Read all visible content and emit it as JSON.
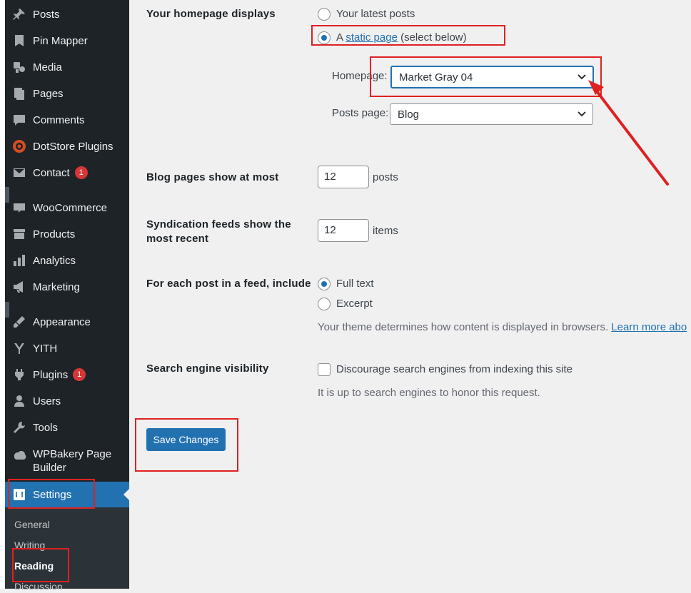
{
  "sidebar": {
    "items": [
      {
        "label": "Posts",
        "icon": "pin-icon"
      },
      {
        "label": "Pin Mapper",
        "icon": "pin-mapper-icon"
      },
      {
        "label": "Media",
        "icon": "media-icon"
      },
      {
        "label": "Pages",
        "icon": "pages-icon"
      },
      {
        "label": "Comments",
        "icon": "comments-icon"
      },
      {
        "label": "DotStore Plugins",
        "icon": "dotstore-icon"
      },
      {
        "label": "Contact",
        "icon": "mail-icon",
        "badge": "1"
      },
      {
        "label": "WooCommerce",
        "icon": "woo-icon"
      },
      {
        "label": "Products",
        "icon": "products-icon"
      },
      {
        "label": "Analytics",
        "icon": "analytics-icon"
      },
      {
        "label": "Marketing",
        "icon": "megaphone-icon"
      },
      {
        "label": "Appearance",
        "icon": "brush-icon"
      },
      {
        "label": "YITH",
        "icon": "yith-icon"
      },
      {
        "label": "Plugins",
        "icon": "plugin-icon",
        "badge": "1"
      },
      {
        "label": "Users",
        "icon": "users-icon"
      },
      {
        "label": "Tools",
        "icon": "wrench-icon"
      },
      {
        "label": "WPBakery Page Builder",
        "icon": "wpbakery-icon"
      },
      {
        "label": "Settings",
        "icon": "settings-icon"
      }
    ],
    "submenu": [
      "General",
      "Writing",
      "Reading",
      "Discussion"
    ]
  },
  "reading": {
    "homepage_displays": {
      "label": "Your homepage displays",
      "option_latest": "Your latest posts",
      "option_static_prefix": "A",
      "option_static_link": "static page",
      "option_static_suffix": "(select below)",
      "homepage_label": "Homepage:",
      "homepage_value": "Market Gray 04",
      "posts_page_label": "Posts page:",
      "posts_page_value": "Blog"
    },
    "blog_pages": {
      "label": "Blog pages show at most",
      "value": "12",
      "unit": "posts"
    },
    "syndication": {
      "label_line1": "Syndication feeds show the",
      "label_line2": "most recent",
      "value": "12",
      "unit": "items"
    },
    "feed_include": {
      "label": "For each post in a feed, include",
      "option_full": "Full text",
      "option_excerpt": "Excerpt",
      "desc": "Your theme determines how content is displayed in browsers.",
      "learn_more": "Learn more abo"
    },
    "search_visibility": {
      "label": "Search engine visibility",
      "checkbox_label": "Discourage search engines from indexing this site",
      "desc": "It is up to search engines to honor this request."
    },
    "save_label": "Save Changes"
  },
  "colors": {
    "accent": "#2271b1",
    "annotation": "#e02020",
    "sidebar": "#1d2327"
  }
}
